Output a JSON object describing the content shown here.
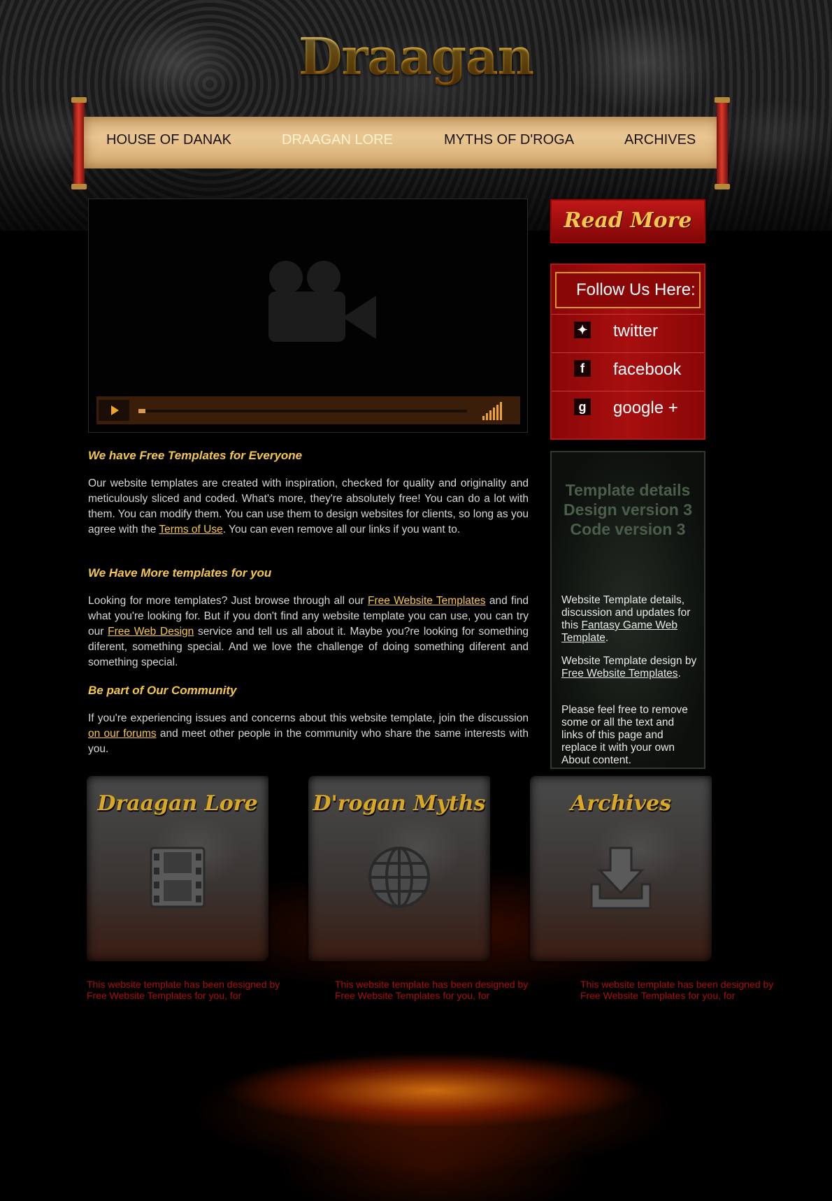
{
  "header": {
    "logo": "Draagan",
    "nav": [
      {
        "label": "HOUSE OF DANAK",
        "active": false
      },
      {
        "label": "DRAAGAN LORE",
        "active": true
      },
      {
        "label": "MYTHS OF D'ROGA",
        "active": false
      },
      {
        "label": "ARCHIVES",
        "active": false
      }
    ]
  },
  "video": {
    "player": "video-player",
    "progress": 0.02
  },
  "main": {
    "sections": [
      {
        "heading": "We have Free Templates for Everyone",
        "p_before": "Our website templates are created with inspiration, checked for quality and originality and meticulously sliced and coded. What's more, they're absolutely free! You can do a lot with them. You can modify them. You can use them to design websites for clients, so long as you agree with the ",
        "link": "Terms of Use",
        "p_after": ". You can even remove all our links if you want to."
      },
      {
        "heading": "We Have More templates for you",
        "p_before": "Looking for more templates? Just browse through all our ",
        "link": "Free Website Templates",
        "p_mid": " and find what you're looking for. But if you don't find any website template you can use, you can try our ",
        "link2": "Free Web Design",
        "p_after": " service and tell us all about it. Maybe you?re looking for something diferent, something special. And we love the challenge of doing something diferent and something special."
      },
      {
        "heading": "Be part of Our Community",
        "p_before": "If you're experiencing issues and concerns about this website template, join the discussion ",
        "link": "on our forums",
        "p_after": " and meet other people in the community who share the same interests with you."
      }
    ]
  },
  "sidebar": {
    "read_more": "Read More",
    "follow_title": "Follow Us Here:",
    "social": [
      {
        "label": "twitter",
        "icon": "twitter-icon"
      },
      {
        "label": "facebook",
        "icon": "facebook-icon"
      },
      {
        "label": "google +",
        "icon": "google-plus-icon"
      }
    ],
    "details_title": "Template details Design version 3 Code version 3",
    "details_p1_before": "Website Template details, discussion and updates for this ",
    "details_p1_link": "Fantasy Game Web Template",
    "details_p1_after": ".",
    "details_p2_before": "Website Template design by ",
    "details_p2_link": "Free Website Templates",
    "details_p2_after": ".",
    "details_p3": "Please feel free to remove some or all the text and links of this page and replace it with your own About content."
  },
  "tiles": [
    {
      "title": "Draagan Lore",
      "icon": "film-icon",
      "caption": "This website template has been designed by Free Website Templates for you, for"
    },
    {
      "title": "D'rogan Myths",
      "icon": "globe-icon",
      "caption": "This website template has been designed by Free Website Templates for you, for"
    },
    {
      "title": "Archives",
      "icon": "download-icon",
      "caption": "This website template has been designed by Free Website Templates for you, for"
    }
  ],
  "colors": {
    "accent": "#f5c84b",
    "red": "#a80f0f",
    "nav_active": "#fff3d0"
  }
}
